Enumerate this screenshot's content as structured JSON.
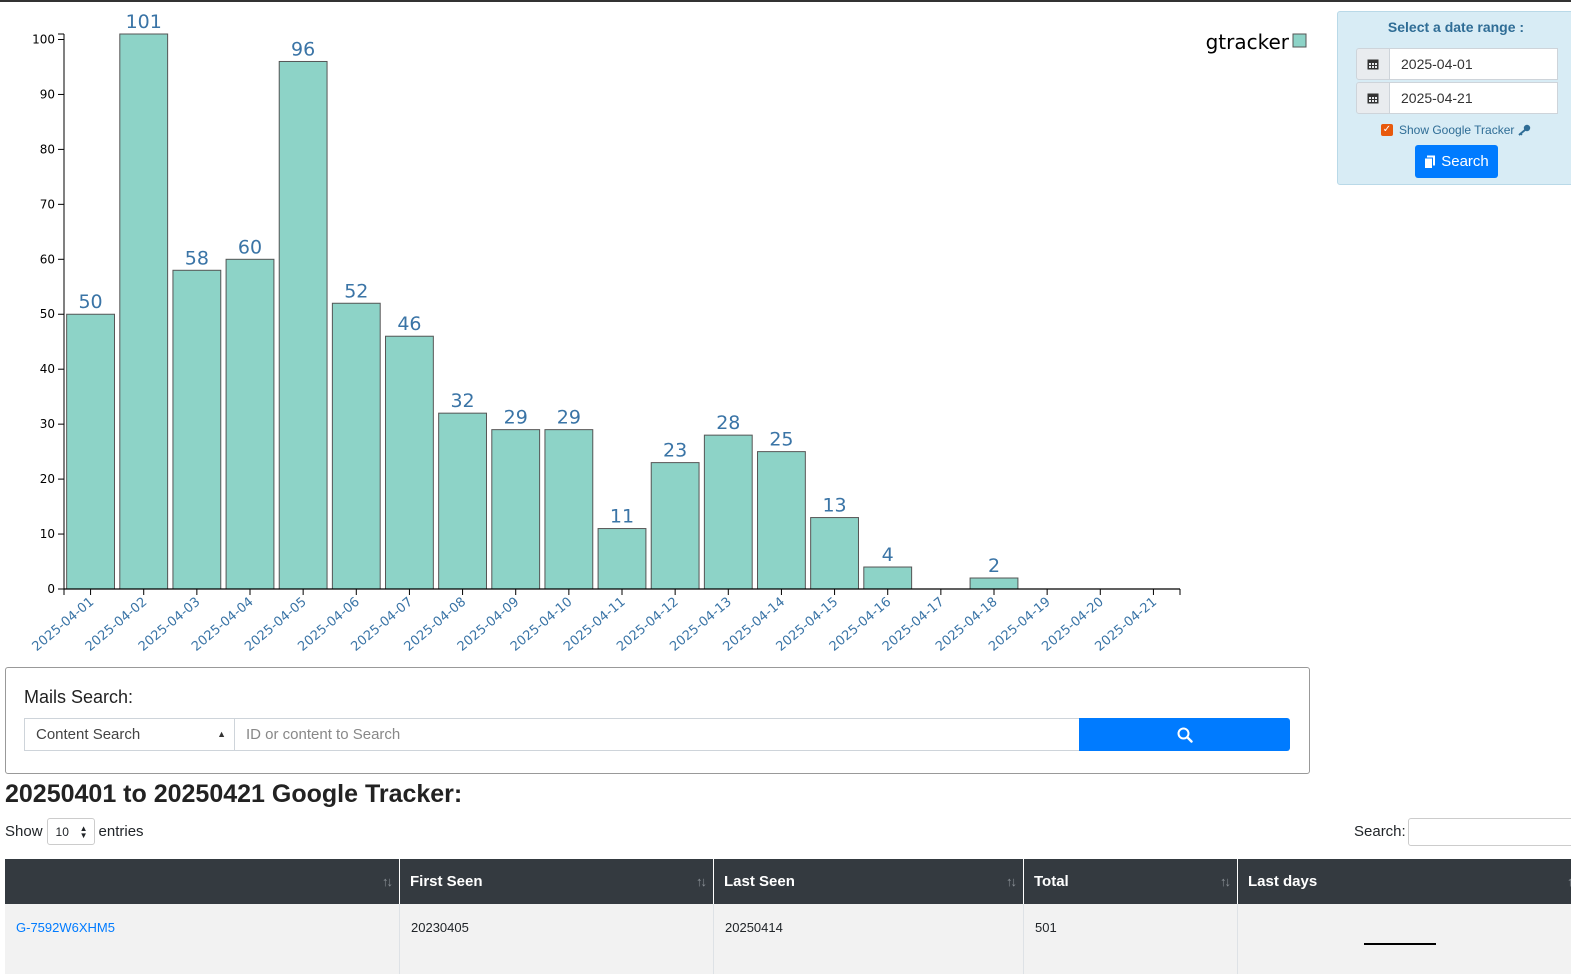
{
  "chart_data": {
    "type": "bar",
    "categories": [
      "2025-04-01",
      "2025-04-02",
      "2025-04-03",
      "2025-04-04",
      "2025-04-05",
      "2025-04-06",
      "2025-04-07",
      "2025-04-08",
      "2025-04-09",
      "2025-04-10",
      "2025-04-11",
      "2025-04-12",
      "2025-04-13",
      "2025-04-14",
      "2025-04-15",
      "2025-04-16",
      "2025-04-17",
      "2025-04-18",
      "2025-04-19",
      "2025-04-20",
      "2025-04-21"
    ],
    "series": [
      {
        "name": "gtracker",
        "values": [
          50,
          101,
          58,
          60,
          96,
          52,
          46,
          32,
          29,
          29,
          11,
          23,
          28,
          25,
          13,
          4,
          0,
          2,
          0,
          0,
          0
        ]
      }
    ],
    "value_labels": [
      "50",
      "101",
      "58",
      "60",
      "96",
      "52",
      "46",
      "32",
      "29",
      "29",
      "11",
      "23",
      "28",
      "25",
      "13",
      "4",
      "",
      "2",
      "",
      "",
      ""
    ],
    "yticks": [
      0,
      10,
      20,
      30,
      40,
      50,
      60,
      70,
      80,
      90,
      100
    ],
    "ylim": [
      0,
      101
    ],
    "title": "",
    "xlabel": "",
    "ylabel": "",
    "legend": "top-right",
    "bar_color": "#8dd3c7",
    "bar_stroke": "#555555",
    "label_color": "#3a74a6"
  },
  "date_range": {
    "title": "Select a date range :",
    "start": "2025-04-01",
    "end": "2025-04-21",
    "show_google_tracker": "Show Google Tracker",
    "search_label": "Search"
  },
  "mails_search": {
    "title": "Mails Search:",
    "select_value": "Content Search",
    "placeholder": "ID or content to Search"
  },
  "page_title": "20250401 to 20250421 Google Tracker:",
  "table_controls": {
    "show": "Show",
    "length": "10",
    "entries": "entries",
    "search": "Search:"
  },
  "table": {
    "headers": [
      "",
      "First Seen",
      "Last Seen",
      "Total",
      "Last days"
    ],
    "rows": [
      {
        "id": "G-7592W6XHM5",
        "first_seen": "20230405",
        "last_seen": "20250414",
        "total": "501"
      }
    ]
  },
  "colors": {
    "accent": "#007bff",
    "header_bg": "#343a40",
    "panel_bg": "#d8ecf5"
  }
}
